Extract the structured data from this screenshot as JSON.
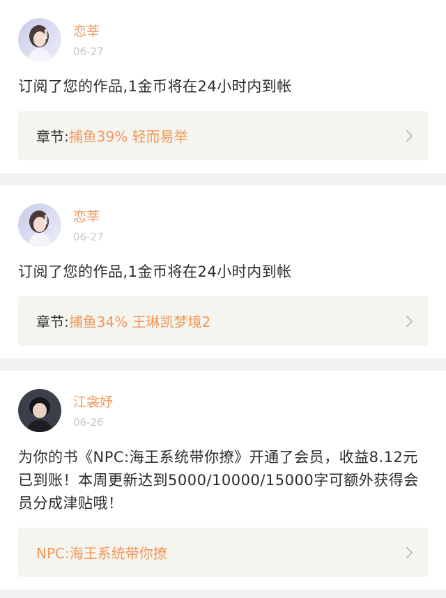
{
  "notifications": [
    {
      "avatar": "avatar-girl-light",
      "name": "恋莘",
      "date": "06-27",
      "message": "订阅了您的作品,1金币将在24小时内到帐",
      "link_prefix": "章节:",
      "link_title": "捕鱼39% 轻而易举"
    },
    {
      "avatar": "avatar-girl-light",
      "name": "恋莘",
      "date": "06-27",
      "message": "订阅了您的作品,1金币将在24小时内到帐",
      "link_prefix": "章节:",
      "link_title": "捕鱼34% 王琳凯梦境2"
    },
    {
      "avatar": "avatar-boy-dark",
      "name": "江衾妤",
      "date": "06-26",
      "message": "为你的书《NPC:海王系统带你撩》开通了会员，收益8.12元已到账！本周更新达到5000/10000/15000字可额外获得会员分成津贴哦！",
      "link_prefix": "",
      "link_title": "NPC:海王系统带你撩"
    }
  ],
  "colors": {
    "accent": "#f0975a",
    "link_bg": "#f5f5ef",
    "page_bg": "#f2f2f2"
  }
}
